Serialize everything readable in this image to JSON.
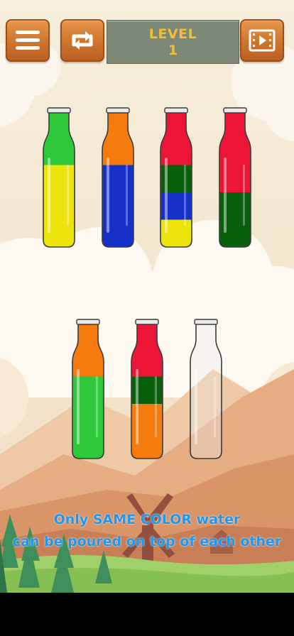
{
  "header": {
    "menu_button": {
      "icon": "hamburger-menu-icon"
    },
    "restart_button": {
      "icon": "restart-arrows-icon"
    },
    "level": {
      "title": "LEVEL",
      "number": "1"
    },
    "video_button": {
      "icon": "video-play-icon"
    }
  },
  "colors": {
    "green": "#2ec93a",
    "yellow": "#ece40a",
    "orange": "#f77b0c",
    "blue": "#1631c7",
    "red": "#ec1536",
    "dark_green": "#08600d",
    "level_text": "#f3bd37",
    "hint_text": "#1e98f0"
  },
  "game": {
    "bottles": [
      {
        "layers_top_to_bottom": [
          "green",
          "yellow",
          "yellow",
          "yellow"
        ]
      },
      {
        "layers_top_to_bottom": [
          "orange",
          "blue",
          "blue",
          "blue"
        ]
      },
      {
        "layers_top_to_bottom": [
          "red",
          "dark_green",
          "blue",
          "yellow"
        ]
      },
      {
        "layers_top_to_bottom": [
          "red",
          "red",
          "dark_green",
          "dark_green"
        ]
      },
      {
        "layers_top_to_bottom": [
          "orange",
          "green",
          "green",
          "green"
        ]
      },
      {
        "layers_top_to_bottom": [
          "red",
          "dark_green",
          "orange",
          "orange"
        ]
      },
      {
        "layers_top_to_bottom": []
      }
    ]
  },
  "hint": {
    "line1": "Only SAME COLOR water",
    "line2": "can be poured on top of each other"
  }
}
